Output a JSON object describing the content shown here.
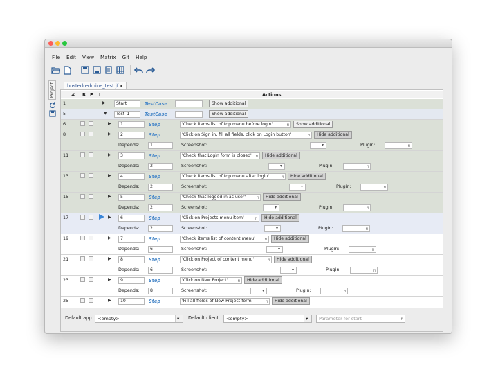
{
  "menu": [
    "File",
    "Edit",
    "View",
    "Matrix",
    "Git",
    "Help"
  ],
  "sidebar": {
    "project_tab": "Project"
  },
  "file_tab": {
    "name": "hostedredmine_test.jf",
    "close": "x"
  },
  "header": {
    "num": "#",
    "r": "R",
    "e": "E",
    "i": "I",
    "actions": "Actions"
  },
  "labels": {
    "depends": "Depends:",
    "screenshot": "Screenshot:",
    "plugin": "Plugin:",
    "step": "Step",
    "testcase": "TestCase",
    "show_additional": "Show additional",
    "hide_additional": "Hide additional",
    "fi": "fi"
  },
  "rows": [
    {
      "num": "1",
      "id": "Start",
      "kind": "testcase",
      "button": "show"
    },
    {
      "num": "5",
      "id": "Test_1",
      "kind": "testcase",
      "button": "show"
    },
    {
      "num": "6",
      "id": "1",
      "kind": "step",
      "text": "'Check items list of top menu before login'",
      "button": "show"
    },
    {
      "num": "8",
      "id": "2",
      "kind": "step",
      "text": "'Click on Sign in, fill all fields, click on Login button'",
      "button": "hide",
      "depends": "1"
    },
    {
      "num": "11",
      "id": "3",
      "kind": "step",
      "text": "'Check that Login form is closed'",
      "button": "hide",
      "depends": "2"
    },
    {
      "num": "13",
      "id": "4",
      "kind": "step",
      "text": "'Check items list of top menu after login'",
      "button": "hide",
      "depends": "2"
    },
    {
      "num": "15",
      "id": "5",
      "kind": "step",
      "text": "'Check that logged in as user'",
      "button": "hide",
      "depends": "2"
    },
    {
      "num": "17",
      "id": "6",
      "kind": "step",
      "text": "'Click on Projects menu item'",
      "button": "hide",
      "depends": "2",
      "selected": true
    },
    {
      "num": "19",
      "id": "7",
      "kind": "step",
      "text": "'Check items list of content menu'",
      "button": "hide",
      "depends": "6"
    },
    {
      "num": "21",
      "id": "8",
      "kind": "step",
      "text": "'Click on Project of content menu'",
      "button": "hide",
      "depends": "6"
    },
    {
      "num": "23",
      "id": "9",
      "kind": "step",
      "text": "'Click on New Project'",
      "button": "hide",
      "depends": "8"
    },
    {
      "num": "25",
      "id": "10",
      "kind": "step",
      "text": "'Fill all fields of New Project form'",
      "button": "hide"
    }
  ],
  "footer": {
    "default_app_label": "Default app",
    "default_app_value": "<empty>",
    "default_client_label": "Default client",
    "default_client_value": "<empty>",
    "param_placeholder": "Parameter for start",
    "fi": "fi"
  },
  "colors": {
    "accent": "#4c8ac9",
    "group_row": "#dbe0d7",
    "selected_row": "#e7ebf5",
    "play_arrow": "#3a86d8"
  }
}
